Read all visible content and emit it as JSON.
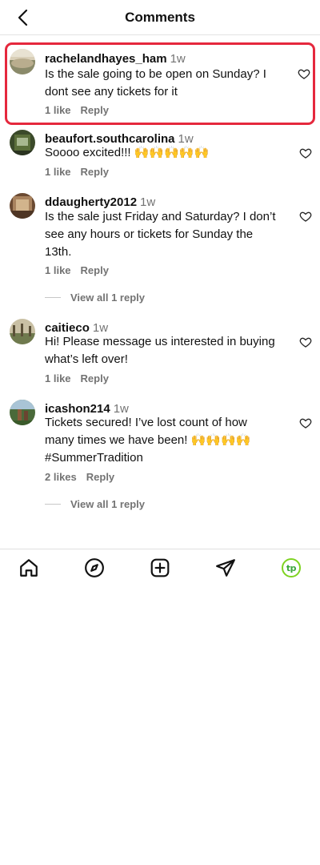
{
  "header": {
    "title": "Comments"
  },
  "comments": [
    {
      "username": "rachelandhayes_ham",
      "time": "1w",
      "text": "Is the sale going to be open on Sunday? I dont see any tickets for it",
      "likes": "1 like",
      "reply_label": "Reply",
      "highlighted": true
    },
    {
      "username": "beaufort.southcarolina",
      "time": "1w",
      "text": "Soooo excited!!! 🙌🙌🙌🙌🙌",
      "likes": "1 like",
      "reply_label": "Reply"
    },
    {
      "username": "ddaugherty2012",
      "time": "1w",
      "text": "Is the sale just Friday and Saturday? I don’t see any hours or tickets for Sunday the 13th.",
      "likes": "1 like",
      "reply_label": "Reply",
      "view_replies": "View all 1 reply"
    },
    {
      "username": "caitieco",
      "time": "1w",
      "text": "Hi! Please message us interested in buying what’s left over!",
      "likes": "1 like",
      "reply_label": "Reply"
    },
    {
      "username": "icashon214",
      "time": "1w",
      "text": "Tickets secured! I’ve lost count of how many times we have been! 🙌🙌🙌🙌 #SummerTradition",
      "likes": "2 likes",
      "reply_label": "Reply",
      "view_replies": "View all 1 reply"
    }
  ],
  "nav": {
    "items": [
      "home-icon",
      "explore-icon",
      "create-icon",
      "direct-icon",
      "profile-avatar"
    ],
    "profile_initials": "tp",
    "accent": "#7ed321"
  },
  "colors": {
    "highlight": "#e5283d",
    "secondary_text": "#737373"
  }
}
